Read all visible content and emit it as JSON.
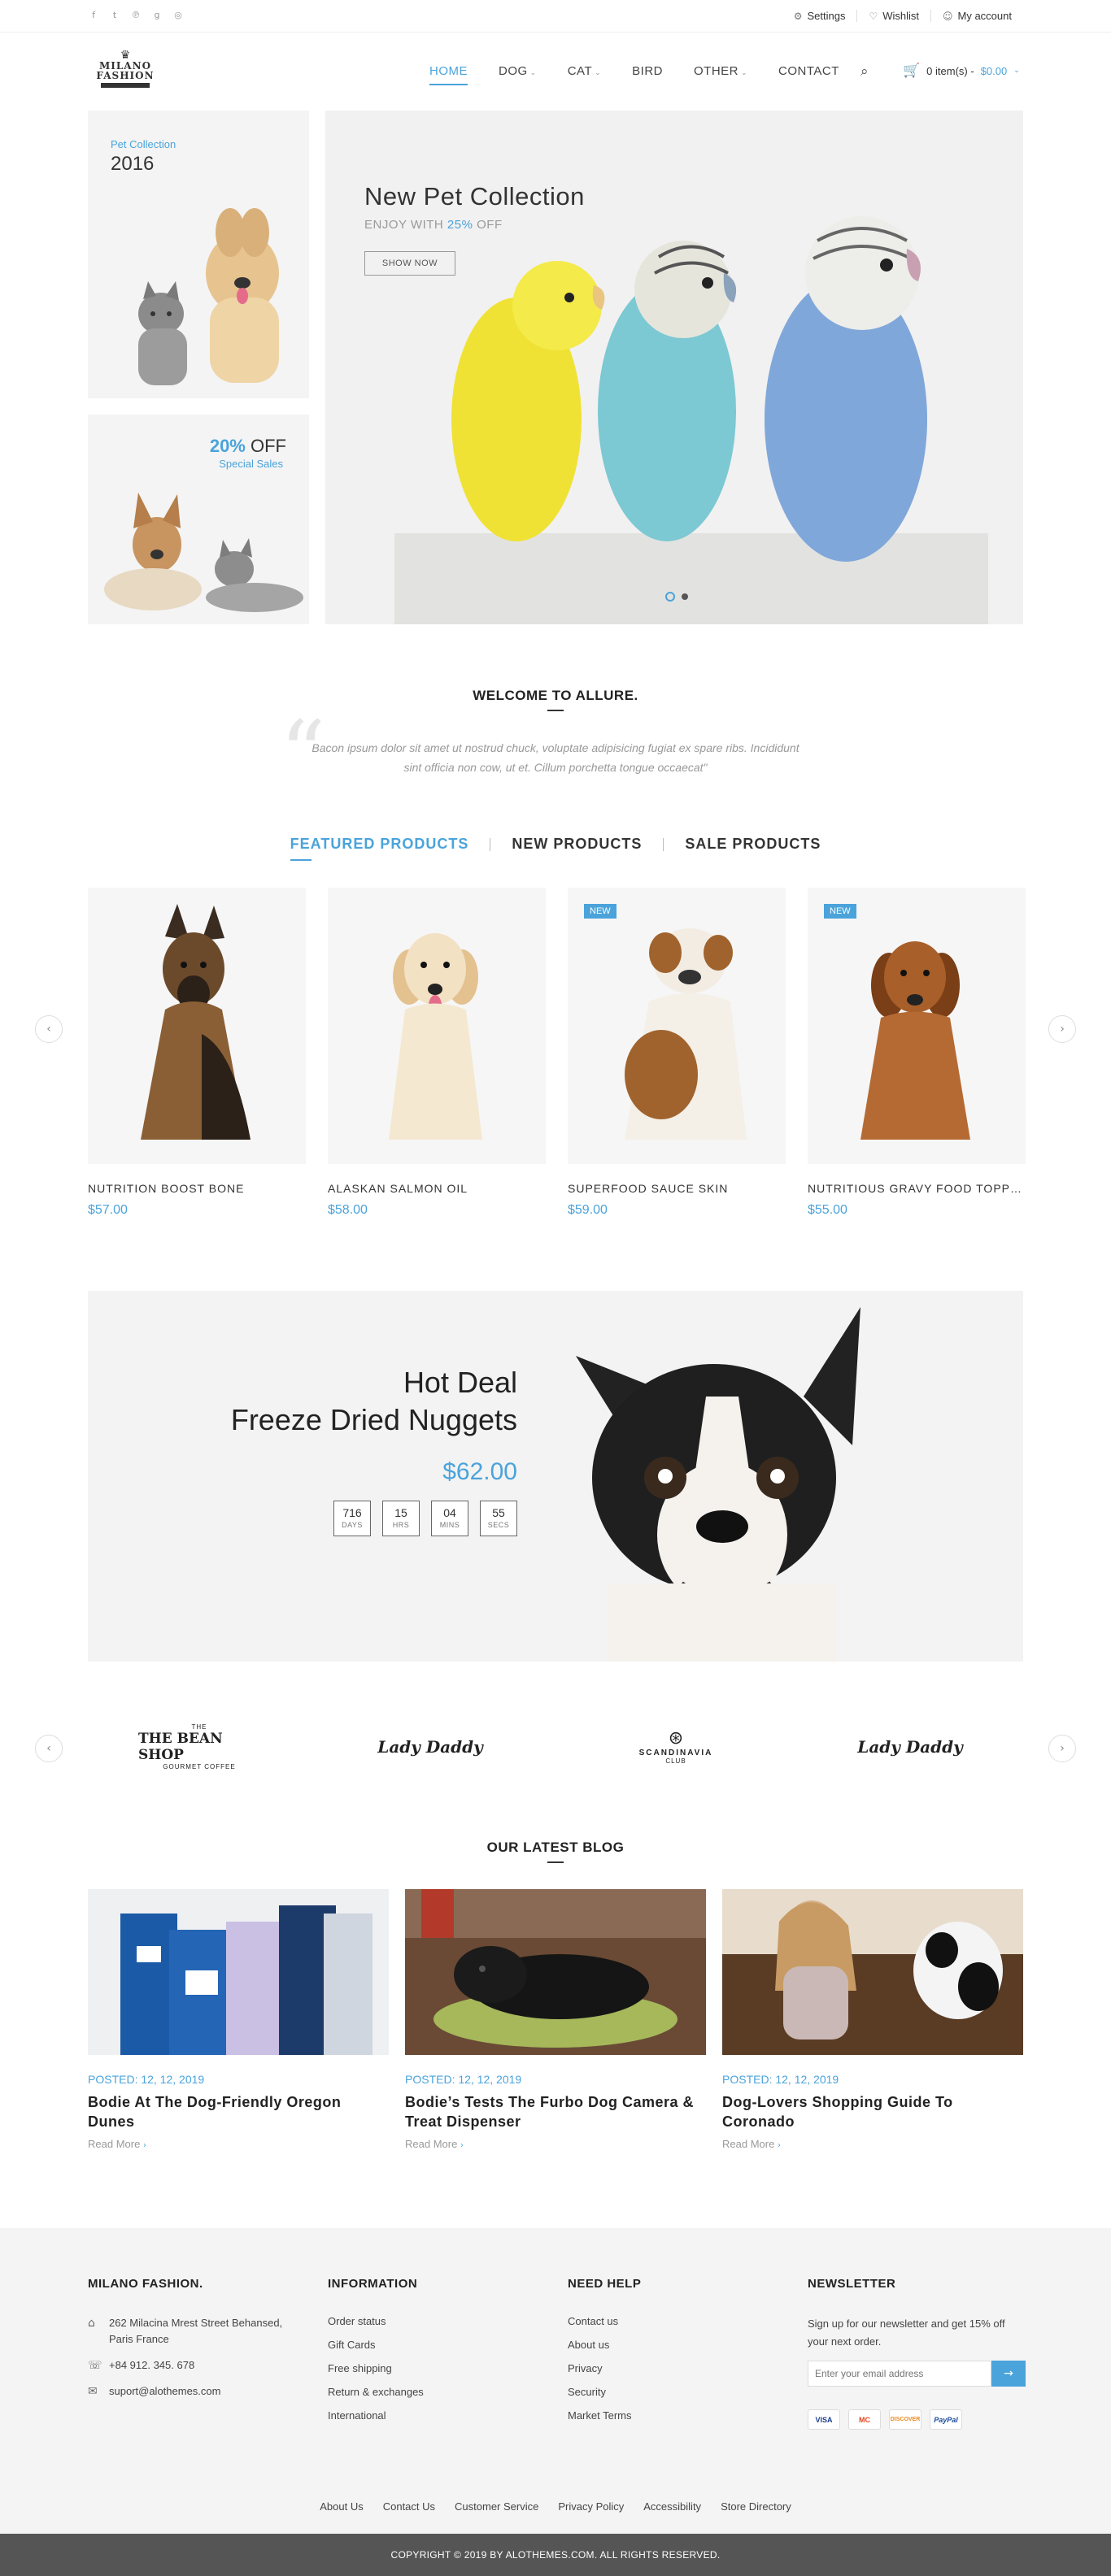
{
  "topbar": {
    "social": [
      "f",
      "t",
      "p",
      "g+",
      "o"
    ],
    "settings": "Settings",
    "wishlist": "Wishlist",
    "account": "My account"
  },
  "header": {
    "logo_line1": "MILANO",
    "logo_line2": "FASHION",
    "nav": [
      {
        "label": "HOME",
        "active": true,
        "has_caret": false
      },
      {
        "label": "DOG",
        "active": false,
        "has_caret": true
      },
      {
        "label": "CAT",
        "active": false,
        "has_caret": true
      },
      {
        "label": "BIRD",
        "active": false,
        "has_caret": false
      },
      {
        "label": "OTHER",
        "active": false,
        "has_caret": true
      },
      {
        "label": "CONTACT",
        "active": false,
        "has_caret": false
      }
    ],
    "cart_items": "0 item(s) -",
    "cart_total": "$0.00"
  },
  "hero": {
    "banner1_sub": "Pet Collection",
    "banner1_year": "2016",
    "banner2_pct": "20%",
    "banner2_off": "OFF",
    "banner2_sub": "Special Sales",
    "slide_title": "New Pet Collection",
    "slide_sub_pre": "ENJOY WITH",
    "slide_sub_pct": "25%",
    "slide_sub_post": "OFF",
    "slide_button": "SHOW NOW"
  },
  "welcome": {
    "title": "WELCOME TO ALLURE.",
    "text": "Bacon ipsum dolor sit amet ut nostrud chuck, voluptate adipisicing fugiat ex spare ribs. Incididunt sint officia non cow, ut et. Cillum porchetta tongue occaecat\""
  },
  "tabs": [
    "FEATURED PRODUCTS",
    "NEW PRODUCTS",
    "SALE PRODUCTS"
  ],
  "products": [
    {
      "name": "NUTRITION BOOST BONE",
      "price": "$57.00",
      "badge": ""
    },
    {
      "name": "ALASKAN SALMON OIL",
      "price": "$58.00",
      "badge": ""
    },
    {
      "name": "SUPERFOOD SAUCE SKIN",
      "price": "$59.00",
      "badge": "NEW"
    },
    {
      "name": "NUTRITIOUS GRAVY FOOD TOPPER",
      "price": "$55.00",
      "badge": "NEW"
    }
  ],
  "deal": {
    "line1": "Hot Deal",
    "line2": "Freeze Dried Nuggets",
    "price": "$62.00",
    "countdown": [
      {
        "value": "716",
        "unit": "DAYS"
      },
      {
        "value": "15",
        "unit": "HRS"
      },
      {
        "value": "04",
        "unit": "MINS"
      },
      {
        "value": "55",
        "unit": "SECS"
      }
    ]
  },
  "brands": [
    "THE BEAN SHOP",
    "Lady Daddy",
    "SCANDINAVIA",
    "Lady Daddy"
  ],
  "brand_small": {
    "bean_top": "THE",
    "bean_bottom": "GOURMET COFFEE",
    "scandi_sub": "CLUB"
  },
  "blog": {
    "title": "OUR LATEST BLOG",
    "posts": [
      {
        "date": "POSTED: 12, 12, 2019",
        "title": "Bodie At The Dog-Friendly Oregon Dunes",
        "more": "Read More"
      },
      {
        "date": "POSTED: 12, 12, 2019",
        "title": "Bodie’s Tests The Furbo Dog Camera & Treat Dispenser",
        "more": "Read More"
      },
      {
        "date": "POSTED: 12, 12, 2019",
        "title": "Dog-Lovers Shopping Guide To Coronado",
        "more": "Read More"
      }
    ]
  },
  "footer": {
    "brand_title": "MILANO FASHION.",
    "address": "262 Milacina Mrest Street Behansed, Paris France",
    "phone": "+84 912. 345. 678",
    "email": "suport@alothemes.com",
    "info_title": "INFORMATION",
    "info_links": [
      "Order status",
      "Gift Cards",
      "Free shipping",
      "Return & exchanges",
      "International"
    ],
    "help_title": "NEED HELP",
    "help_links": [
      "Contact us",
      "About us",
      "Privacy",
      "Security",
      "Market Terms"
    ],
    "newsletter_title": "NEWSLETTER",
    "newsletter_text": "Sign up for our newsletter and get 15% off your next order.",
    "newsletter_placeholder": "Enter your email address",
    "payments": [
      "VISA",
      "MC",
      "DISCOVER",
      "PayPal"
    ],
    "bottom_links": [
      "About Us",
      "Contact Us",
      "Customer Service",
      "Privacy Policy",
      "Accessibility",
      "Store Directory"
    ],
    "copyright": "COPYRIGHT © 2019 BY ALOTHEMES.COM. ALL RIGHTS RESERVED."
  },
  "colors": {
    "accent": "#4aa3db",
    "footer_bar": "#555555"
  }
}
